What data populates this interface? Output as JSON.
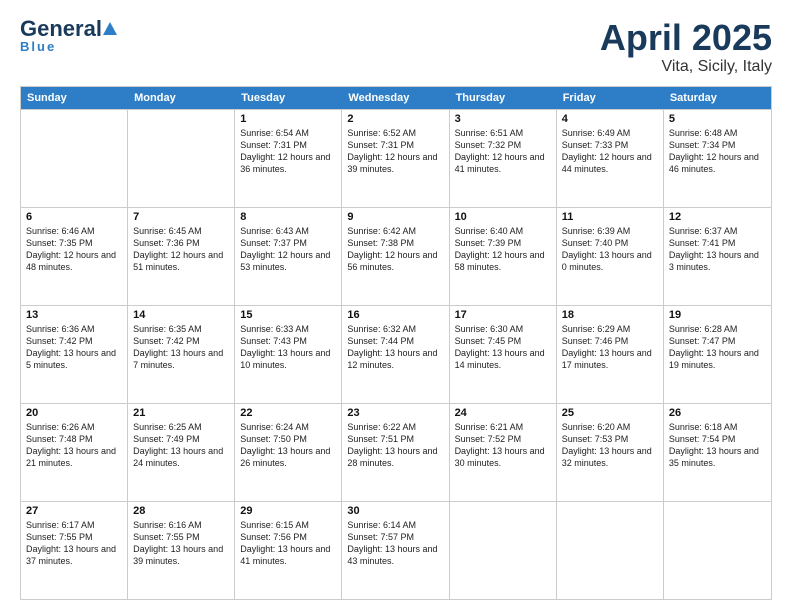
{
  "header": {
    "logo_general": "General",
    "logo_blue": "Blue",
    "month_year": "April 2025",
    "location": "Vita, Sicily, Italy"
  },
  "days_of_week": [
    "Sunday",
    "Monday",
    "Tuesday",
    "Wednesday",
    "Thursday",
    "Friday",
    "Saturday"
  ],
  "weeks": [
    [
      {
        "day": "",
        "info": ""
      },
      {
        "day": "",
        "info": ""
      },
      {
        "day": "1",
        "info": "Sunrise: 6:54 AM\nSunset: 7:31 PM\nDaylight: 12 hours and 36 minutes."
      },
      {
        "day": "2",
        "info": "Sunrise: 6:52 AM\nSunset: 7:31 PM\nDaylight: 12 hours and 39 minutes."
      },
      {
        "day": "3",
        "info": "Sunrise: 6:51 AM\nSunset: 7:32 PM\nDaylight: 12 hours and 41 minutes."
      },
      {
        "day": "4",
        "info": "Sunrise: 6:49 AM\nSunset: 7:33 PM\nDaylight: 12 hours and 44 minutes."
      },
      {
        "day": "5",
        "info": "Sunrise: 6:48 AM\nSunset: 7:34 PM\nDaylight: 12 hours and 46 minutes."
      }
    ],
    [
      {
        "day": "6",
        "info": "Sunrise: 6:46 AM\nSunset: 7:35 PM\nDaylight: 12 hours and 48 minutes."
      },
      {
        "day": "7",
        "info": "Sunrise: 6:45 AM\nSunset: 7:36 PM\nDaylight: 12 hours and 51 minutes."
      },
      {
        "day": "8",
        "info": "Sunrise: 6:43 AM\nSunset: 7:37 PM\nDaylight: 12 hours and 53 minutes."
      },
      {
        "day": "9",
        "info": "Sunrise: 6:42 AM\nSunset: 7:38 PM\nDaylight: 12 hours and 56 minutes."
      },
      {
        "day": "10",
        "info": "Sunrise: 6:40 AM\nSunset: 7:39 PM\nDaylight: 12 hours and 58 minutes."
      },
      {
        "day": "11",
        "info": "Sunrise: 6:39 AM\nSunset: 7:40 PM\nDaylight: 13 hours and 0 minutes."
      },
      {
        "day": "12",
        "info": "Sunrise: 6:37 AM\nSunset: 7:41 PM\nDaylight: 13 hours and 3 minutes."
      }
    ],
    [
      {
        "day": "13",
        "info": "Sunrise: 6:36 AM\nSunset: 7:42 PM\nDaylight: 13 hours and 5 minutes."
      },
      {
        "day": "14",
        "info": "Sunrise: 6:35 AM\nSunset: 7:42 PM\nDaylight: 13 hours and 7 minutes."
      },
      {
        "day": "15",
        "info": "Sunrise: 6:33 AM\nSunset: 7:43 PM\nDaylight: 13 hours and 10 minutes."
      },
      {
        "day": "16",
        "info": "Sunrise: 6:32 AM\nSunset: 7:44 PM\nDaylight: 13 hours and 12 minutes."
      },
      {
        "day": "17",
        "info": "Sunrise: 6:30 AM\nSunset: 7:45 PM\nDaylight: 13 hours and 14 minutes."
      },
      {
        "day": "18",
        "info": "Sunrise: 6:29 AM\nSunset: 7:46 PM\nDaylight: 13 hours and 17 minutes."
      },
      {
        "day": "19",
        "info": "Sunrise: 6:28 AM\nSunset: 7:47 PM\nDaylight: 13 hours and 19 minutes."
      }
    ],
    [
      {
        "day": "20",
        "info": "Sunrise: 6:26 AM\nSunset: 7:48 PM\nDaylight: 13 hours and 21 minutes."
      },
      {
        "day": "21",
        "info": "Sunrise: 6:25 AM\nSunset: 7:49 PM\nDaylight: 13 hours and 24 minutes."
      },
      {
        "day": "22",
        "info": "Sunrise: 6:24 AM\nSunset: 7:50 PM\nDaylight: 13 hours and 26 minutes."
      },
      {
        "day": "23",
        "info": "Sunrise: 6:22 AM\nSunset: 7:51 PM\nDaylight: 13 hours and 28 minutes."
      },
      {
        "day": "24",
        "info": "Sunrise: 6:21 AM\nSunset: 7:52 PM\nDaylight: 13 hours and 30 minutes."
      },
      {
        "day": "25",
        "info": "Sunrise: 6:20 AM\nSunset: 7:53 PM\nDaylight: 13 hours and 32 minutes."
      },
      {
        "day": "26",
        "info": "Sunrise: 6:18 AM\nSunset: 7:54 PM\nDaylight: 13 hours and 35 minutes."
      }
    ],
    [
      {
        "day": "27",
        "info": "Sunrise: 6:17 AM\nSunset: 7:55 PM\nDaylight: 13 hours and 37 minutes."
      },
      {
        "day": "28",
        "info": "Sunrise: 6:16 AM\nSunset: 7:55 PM\nDaylight: 13 hours and 39 minutes."
      },
      {
        "day": "29",
        "info": "Sunrise: 6:15 AM\nSunset: 7:56 PM\nDaylight: 13 hours and 41 minutes."
      },
      {
        "day": "30",
        "info": "Sunrise: 6:14 AM\nSunset: 7:57 PM\nDaylight: 13 hours and 43 minutes."
      },
      {
        "day": "",
        "info": ""
      },
      {
        "day": "",
        "info": ""
      },
      {
        "day": "",
        "info": ""
      }
    ]
  ]
}
